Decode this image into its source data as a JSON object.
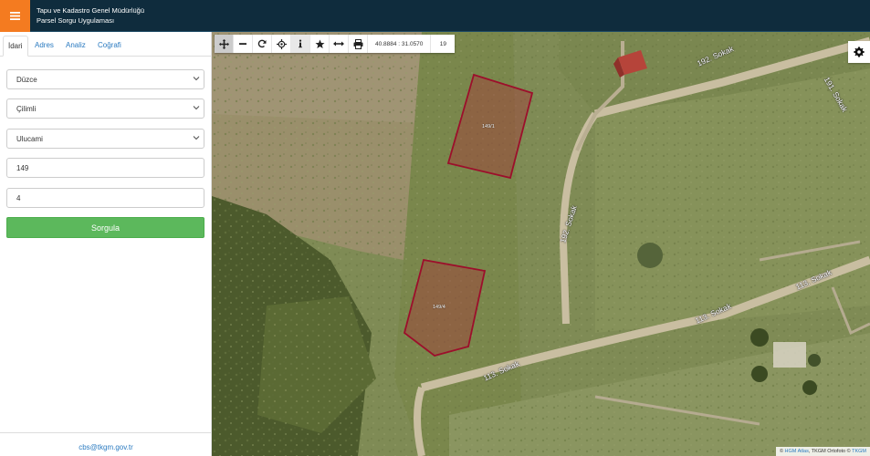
{
  "header": {
    "menu_icon": "hamburger-icon",
    "title_line1": "Tapu ve Kadastro Genel Müdürlüğü",
    "title_line2": "Parsel Sorgu Uygulaması",
    "accent": "#f47b20",
    "background": "#0f2c3d"
  },
  "sidebar": {
    "tabs": [
      {
        "label": "İdari",
        "active": true
      },
      {
        "label": "Adres",
        "active": false
      },
      {
        "label": "Analiz",
        "active": false
      },
      {
        "label": "Coğrafi",
        "active": false
      }
    ],
    "province": "Düzce",
    "district": "Çilimli",
    "neighborhood": "Ulucami",
    "block": "149",
    "parcel": "4",
    "submit_label": "Sorgula",
    "footer_email": "cbs@tkgm.gov.tr"
  },
  "map": {
    "toolbar": {
      "icons": [
        "move-icon",
        "zoom-out-icon",
        "refresh-icon",
        "locate-icon",
        "info-icon",
        "star-icon",
        "measure-icon",
        "print-icon"
      ],
      "coordinates": "40.8884 : 31.0570",
      "zoom": "19"
    },
    "settings_icon": "gear-icon",
    "parcels": [
      {
        "label": "149/1"
      },
      {
        "label": "149/4"
      }
    ],
    "streets": [
      "192. Sokak",
      "191. Sokak",
      "192. Sokak",
      "113. Sokak",
      "113. Sokak",
      "113. Sokak"
    ],
    "attribution": {
      "prefix": "©",
      "link1": "HGM Atlas",
      "middle": ", TKGM Ortofoto ©",
      "link2": "TKGM"
    }
  }
}
